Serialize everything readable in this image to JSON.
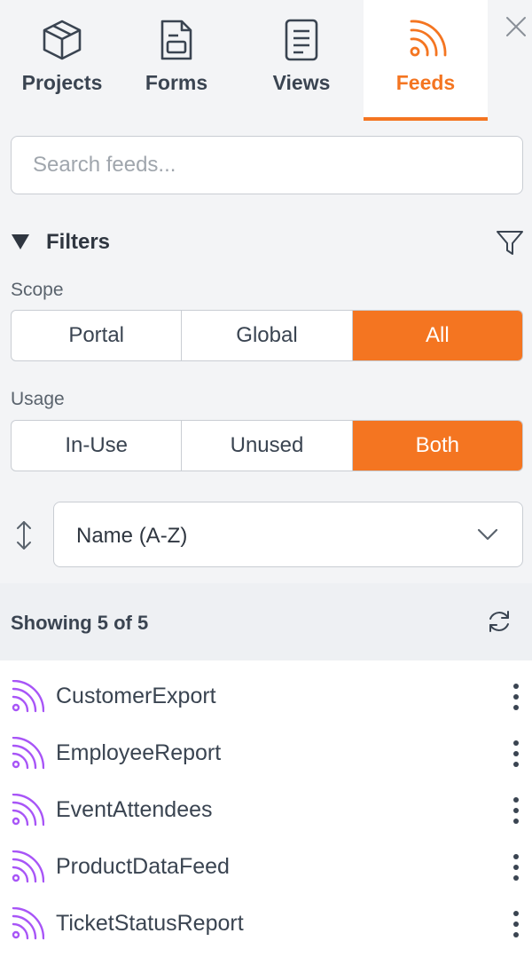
{
  "tabs": [
    {
      "label": "Projects",
      "icon": "box-icon",
      "active": false
    },
    {
      "label": "Forms",
      "icon": "form-icon",
      "active": false
    },
    {
      "label": "Views",
      "icon": "document-icon",
      "active": false
    },
    {
      "label": "Feeds",
      "icon": "rss-icon",
      "active": true
    }
  ],
  "close_icon": "close-icon",
  "search": {
    "placeholder": "Search feeds...",
    "value": ""
  },
  "filters": {
    "title": "Filters",
    "expanded": true,
    "scope": {
      "label": "Scope",
      "options": [
        "Portal",
        "Global",
        "All"
      ],
      "selected": "All"
    },
    "usage": {
      "label": "Usage",
      "options": [
        "In-Use",
        "Unused",
        "Both"
      ],
      "selected": "Both"
    }
  },
  "sort": {
    "selected": "Name (A-Z)"
  },
  "results": {
    "showing_text": "Showing 5 of 5"
  },
  "feeds": [
    {
      "name": "CustomerExport"
    },
    {
      "name": "EmployeeReport"
    },
    {
      "name": "EventAttendees"
    },
    {
      "name": "ProductDataFeed"
    },
    {
      "name": "TicketStatusReport"
    }
  ],
  "colors": {
    "accent": "#f47521",
    "feed_icon": "#a855f7",
    "text": "#3a4451",
    "border": "#c9cdd3"
  }
}
